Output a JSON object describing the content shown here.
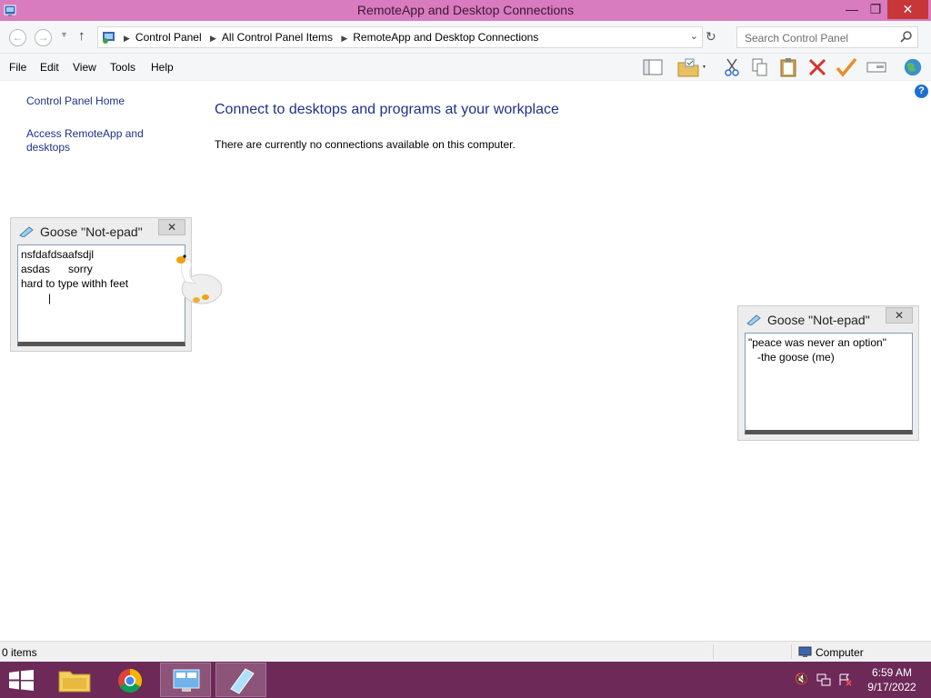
{
  "window": {
    "title": "RemoteApp and Desktop Connections",
    "min_glyph": "—",
    "max_glyph": "❐",
    "close_glyph": "✕"
  },
  "address": {
    "crumbs": [
      "Control Panel",
      "All Control Panel Items",
      "RemoteApp and Desktop Connections"
    ],
    "search_placeholder": "Search Control Panel"
  },
  "menu": [
    "File",
    "Edit",
    "View",
    "Tools",
    "Help"
  ],
  "left_nav": {
    "home": "Control Panel Home",
    "access": "Access RemoteApp and desktops"
  },
  "main": {
    "heading": "Connect to desktops and programs at your workplace",
    "message": "There are currently no connections available on this computer."
  },
  "goose_notepads": [
    {
      "title": "Goose \"Not-epad\"",
      "text": "nsfdafdsaafsdjl\nasdas      sorry\nhard to type withh feet\n         |"
    },
    {
      "title": "Goose \"Not-epad\"",
      "text": "\"peace was never an option\"\n   -the goose (me)"
    }
  ],
  "status": {
    "items": "0 items",
    "location": "Computer"
  },
  "taskbar": {
    "time": "6:59 AM",
    "date": "9/17/2022"
  },
  "colors": {
    "titlebar": "#d97bbf",
    "taskbar": "#6d2957",
    "link": "#1e3287",
    "close": "#c7373a"
  },
  "icons": [
    "control-panel-icon",
    "back-icon",
    "forward-icon",
    "up-icon",
    "refresh-icon",
    "search-icon",
    "help-icon",
    "goose",
    "chrome-icon",
    "file-explorer-icon",
    "notepad-icon",
    "windows-start-icon",
    "volume-muted-icon",
    "network-icon",
    "action-center-icon"
  ]
}
